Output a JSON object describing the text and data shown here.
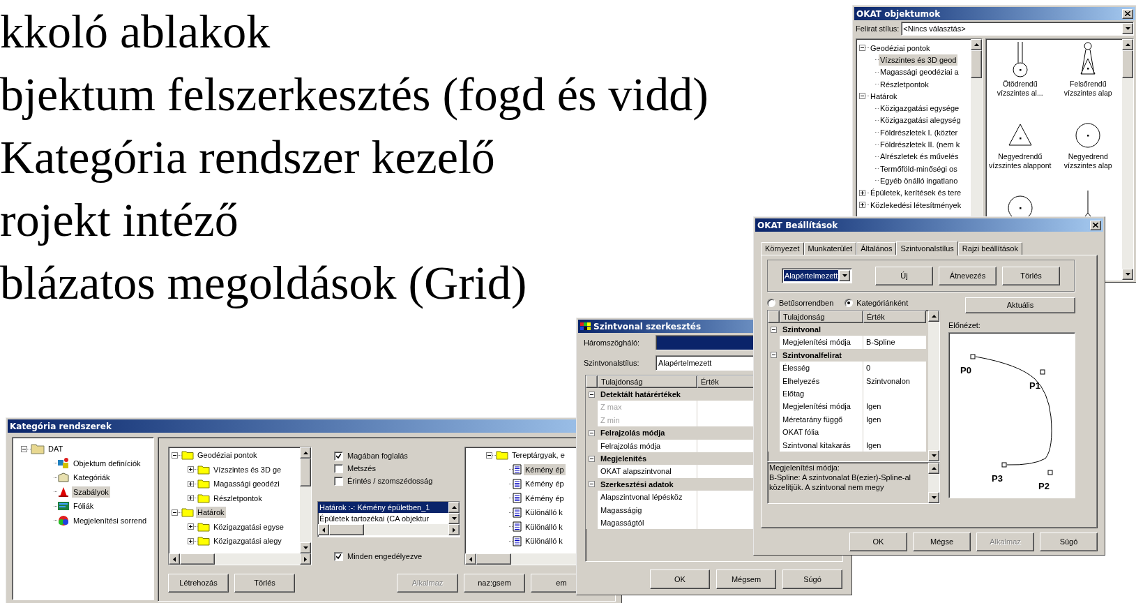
{
  "slide": {
    "lines": [
      "kkoló ablakok",
      "bjektum felszerkesztés (fogd és vidd)",
      "Kategória rendszer kezelő",
      "rojekt intéző",
      "blázatos megoldások (Grid)"
    ]
  },
  "category_window": {
    "title": "Kategória rendszerek",
    "nav_tree": [
      {
        "label": "DAT",
        "expanded": true,
        "selected": false,
        "children": [
          {
            "label": "Objektum definíciók",
            "selected": false
          },
          {
            "label": "Kategóriák",
            "selected": false
          },
          {
            "label": "Szabályok",
            "selected": true
          },
          {
            "label": "Fóliák",
            "selected": false
          },
          {
            "label": "Megjelenítési sorrend",
            "selected": false
          }
        ]
      }
    ],
    "source_tree": [
      {
        "label": "Geodéziai pontok",
        "expanded": true,
        "selected": false,
        "children": [
          {
            "label": "Vízszintes és 3D ge",
            "expanded": false,
            "selected": false
          },
          {
            "label": "Magassági geodézi",
            "expanded": false,
            "selected": false
          },
          {
            "label": "Részletpontok",
            "expanded": false,
            "selected": false
          }
        ]
      },
      {
        "label": "Határok",
        "expanded": true,
        "selected": true,
        "children": [
          {
            "label": "Közigazgatási egyse",
            "expanded": false,
            "selected": false
          },
          {
            "label": "Közigazgatási alegy",
            "expanded": false,
            "selected": false
          }
        ]
      }
    ],
    "tree_buttons": [
      {
        "label": "Létrehozás",
        "disabled": false
      },
      {
        "label": "Törlés",
        "disabled": false
      }
    ],
    "relations": [
      {
        "label": "Magában foglalás",
        "checked": true
      },
      {
        "label": "Metszés",
        "checked": false
      },
      {
        "label": "Érintés / szomszédosság",
        "checked": false
      }
    ],
    "rule_list": [
      {
        "label": "Határok :-: Kémény épületben_1",
        "selected": true
      },
      {
        "label": "Épületek tartozékai (CA objektur",
        "selected": false
      }
    ],
    "enable_all": {
      "label": "Minden engedélyezve",
      "checked": true
    },
    "target_tree": [
      {
        "label": "Tereptárgyak, e",
        "expanded": true,
        "selected": false,
        "children": [
          {
            "label": "Kémény ép",
            "selected": true
          },
          {
            "label": "Kémény ép",
            "selected": false
          },
          {
            "label": "Kémény ép",
            "selected": false
          },
          {
            "label": "Különálló k",
            "selected": false
          },
          {
            "label": "Különálló k",
            "selected": false
          },
          {
            "label": "Különálló k",
            "selected": false
          }
        ]
      }
    ],
    "buttons": [
      {
        "label": "Alkalmaz",
        "disabled": true
      },
      {
        "label": "naz:gsem",
        "disabled": false
      },
      {
        "label": "em",
        "disabled": false
      }
    ]
  },
  "contour_window": {
    "title": "Szintvonal szerkesztés",
    "fields": [
      {
        "label": "Háromszögháló:",
        "selected": true
      },
      {
        "label": "Szintvonalstílus:",
        "value": "Alapértelmezett",
        "selected": false
      }
    ],
    "grid": {
      "columns": [
        "Tulajdonság",
        "Érték"
      ],
      "groups": [
        {
          "title": "Detektált határértékek",
          "expanded": true,
          "rows": [
            {
              "name": "Z max",
              "disabled": true
            },
            {
              "name": "Z min",
              "disabled": true
            }
          ]
        },
        {
          "title": "Felrajzolás módja",
          "expanded": true,
          "rows": [
            {
              "name": "Felrajzolás módja",
              "disabled": false
            }
          ]
        },
        {
          "title": "Megjelenítés",
          "expanded": true,
          "rows": [
            {
              "name": "OKAT alapszintvonal",
              "disabled": false
            }
          ]
        },
        {
          "title": "Szerkesztési adatok",
          "expanded": true,
          "rows": [
            {
              "name": "Alapszintvonal lépésköz",
              "disabled": false
            },
            {
              "name": "Magasságig",
              "disabled": false
            },
            {
              "name": "Magasságtól",
              "disabled": false
            }
          ]
        }
      ]
    },
    "buttons": [
      {
        "label": "OK",
        "disabled": false
      },
      {
        "label": "Mégsem",
        "disabled": false
      },
      {
        "label": "Súgó",
        "disabled": false
      }
    ]
  },
  "objects_window": {
    "title": "OKAT objektumok",
    "caption_style": {
      "label": "Felirat stílus:",
      "value": "<Nincs választás>"
    },
    "tree": [
      {
        "label": "Geodéziai pontok",
        "expanded": true,
        "selected": false,
        "children": [
          {
            "label": "Vízszintes és 3D geod",
            "selected": true
          },
          {
            "label": "Magassági geodéziai a",
            "selected": false
          },
          {
            "label": "Részletpontok",
            "selected": false
          }
        ]
      },
      {
        "label": "Határok",
        "expanded": true,
        "selected": false,
        "children": [
          {
            "label": "Közigazgatási egysége",
            "selected": false
          },
          {
            "label": "Közigazgatási alegység",
            "selected": false
          },
          {
            "label": "Földrészletek I. (közter",
            "selected": false
          },
          {
            "label": "Földrészletek II. (nem k",
            "selected": false
          },
          {
            "label": "Alrészletek és művelés",
            "selected": false
          },
          {
            "label": "Termőföld-minőségi os",
            "selected": false
          },
          {
            "label": "Egyéb önálló ingatlano",
            "selected": false
          }
        ]
      },
      {
        "label": "Épületek, kerítések és tere",
        "expanded": false,
        "selected": false
      },
      {
        "label": "Közlekedési létesítmények",
        "expanded": false,
        "selected": false
      }
    ],
    "symbols": [
      {
        "kind": "mast",
        "label": [
          "Ötödrendű",
          "vízszintes al..."
        ]
      },
      {
        "kind": "tower",
        "label": [
          "Felsőrendű",
          "vízszintes alap"
        ]
      },
      {
        "kind": "triangle",
        "label": [
          "Negyedrendű",
          "vízszintes alappont"
        ]
      },
      {
        "kind": "circle",
        "label": [
          "Negyedrend",
          "vízszintes alap"
        ]
      },
      {
        "kind": "circle"
      },
      {
        "kind": "pole"
      }
    ]
  },
  "settings_window": {
    "title": "OKAT Beállítások",
    "tabs": [
      {
        "label": "Környezet",
        "selected": false
      },
      {
        "label": "Munkaterület",
        "selected": false
      },
      {
        "label": "Általános",
        "selected": false
      },
      {
        "label": "Szintvonalstílus",
        "selected": true
      },
      {
        "label": "Rajzi beállítások",
        "selected": false
      }
    ],
    "style_select": "Alapértelmezett",
    "style_buttons": [
      {
        "label": "Új",
        "disabled": false
      },
      {
        "label": "Átnevezés",
        "disabled": false
      },
      {
        "label": "Törlés",
        "disabled": false
      }
    ],
    "sort_options": [
      {
        "label": "Betűsorrendben",
        "selected": false
      },
      {
        "label": "Kategóriánként",
        "selected": true
      }
    ],
    "current_button": "Aktuális",
    "grid": {
      "columns": [
        "Tulajdonság",
        "Érték"
      ],
      "groups": [
        {
          "title": "Szintvonal",
          "expanded": true,
          "rows": [
            {
              "name": "Megjelenítési módja",
              "value": "B-Spline",
              "disabled": false
            }
          ]
        },
        {
          "title": "Szintvonalfelirat",
          "expanded": true,
          "rows": [
            {
              "name": "Élesség",
              "value": "0",
              "disabled": false
            },
            {
              "name": "Elhelyezés",
              "value": "Szintvonalon",
              "disabled": false
            },
            {
              "name": "Előtag",
              "disabled": false
            },
            {
              "name": "Megjelenítési módja",
              "value": "Igen",
              "disabled": false
            },
            {
              "name": "Méretarány függő",
              "value": "Igen",
              "disabled": false
            },
            {
              "name": "OKAT fólia",
              "disabled": false
            },
            {
              "name": "Szintvonal kitakarás",
              "value": "Igen",
              "disabled": false
            }
          ]
        }
      ]
    },
    "description": {
      "title": "Megjelenítési módja:",
      "text": "B-Spline: A szintvonalat B(ezier)-Spline-al közelítjük. A szintvonal nem megy"
    },
    "preview": {
      "label": "Előnézet:",
      "points": [
        "P0",
        "P1",
        "P2",
        "P3"
      ]
    },
    "buttons": [
      {
        "label": "OK",
        "disabled": false
      },
      {
        "label": "Mégse",
        "disabled": false
      },
      {
        "label": "Alkalmaz",
        "disabled": true
      },
      {
        "label": "Súgó",
        "disabled": false
      }
    ]
  }
}
